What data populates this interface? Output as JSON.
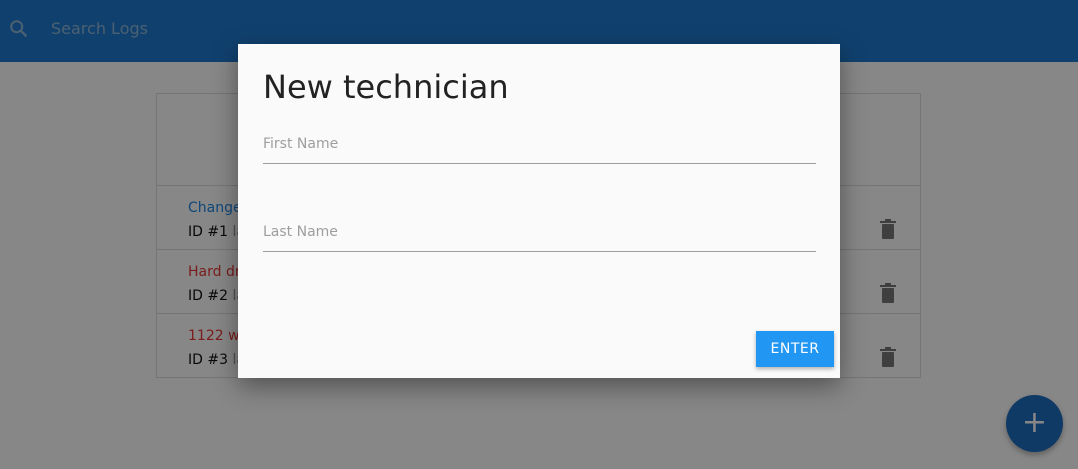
{
  "header": {
    "search_placeholder": "Search Logs",
    "icon": "search-icon"
  },
  "logs": [
    {
      "message": "Change",
      "color": "#1e88e5",
      "id": "ID #1",
      "tech": "la"
    },
    {
      "message": "Hard dr",
      "color": "#e53935",
      "id": "ID #2",
      "tech": "la"
    },
    {
      "message": "1122 wi",
      "color": "#e53935",
      "id": "ID #3",
      "tech": "la"
    }
  ],
  "fab": {
    "label": "+"
  },
  "modal": {
    "title": "New technician",
    "first_name_label": "First Name",
    "last_name_label": "Last Name",
    "enter_label": "ENTER"
  },
  "colors": {
    "header": "#1f7bd0",
    "button": "#2196f3"
  }
}
